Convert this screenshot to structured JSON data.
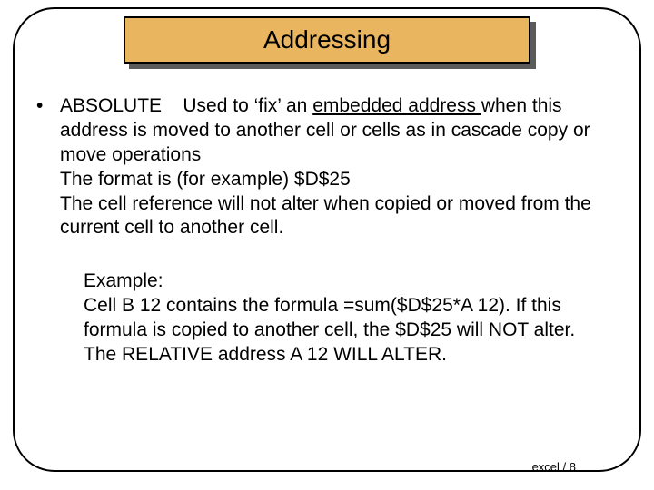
{
  "title": "Addressing",
  "bullet": {
    "term": "ABSOLUTE",
    "lead_text": "Used to ‘fix’ an ",
    "underlined": "embedded address ",
    "rest": "when this address is moved to another cell or cells as in cascade copy or move operations",
    "line2": "The format is (for example)  $D$25",
    "line3": "The cell reference will not alter when copied or moved from the current cell to another cell."
  },
  "example": {
    "l1": "Example:",
    "l2": "Cell B 12 contains the formula =sum($D$25*A 12).  If this formula is copied to another cell, the $D$25 will NOT alter.",
    "l3": "The RELATIVE address A 12 WILL ALTER."
  },
  "footer": "excel / 8"
}
